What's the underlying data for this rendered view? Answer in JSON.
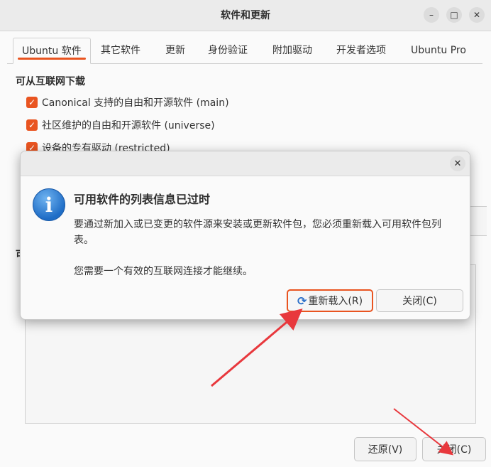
{
  "window": {
    "title": "软件和更新",
    "controls": [
      "minimize-icon",
      "maximize-icon",
      "close-icon"
    ]
  },
  "tabs": [
    {
      "label": "Ubuntu 软件",
      "active": true
    },
    {
      "label": "其它软件"
    },
    {
      "label": "更新"
    },
    {
      "label": "身份验证"
    },
    {
      "label": "附加驱动"
    },
    {
      "label": "开发者选项"
    },
    {
      "label": "Ubuntu Pro"
    }
  ],
  "main": {
    "section_title": "可从互联网下载",
    "checkboxes": [
      {
        "label": "Canonical 支持的自由和开源软件 (main)",
        "checked": true
      },
      {
        "label": "社区维护的自由和开源软件 (universe)",
        "checked": true
      },
      {
        "label": "设备的专有驱动 (restricted)",
        "checked": true
      }
    ],
    "partial_label": "可"
  },
  "footer": {
    "revert_label": "还原(V)",
    "close_label": "关闭(C)"
  },
  "dialog": {
    "title": "可用软件的列表信息已过时",
    "body": "要通过新加入或已变更的软件源来安装或更新软件包，您必须重新载入可用软件包列表。",
    "body2": "您需要一个有效的互联网连接才能继续。",
    "reload_label": "重新载入(R)",
    "close_label": "关闭(C)",
    "icon": "info-icon"
  },
  "colors": {
    "accent": "#e95420",
    "annotation_arrow": "#e8383d",
    "info_blue": "#1f6dc6"
  }
}
